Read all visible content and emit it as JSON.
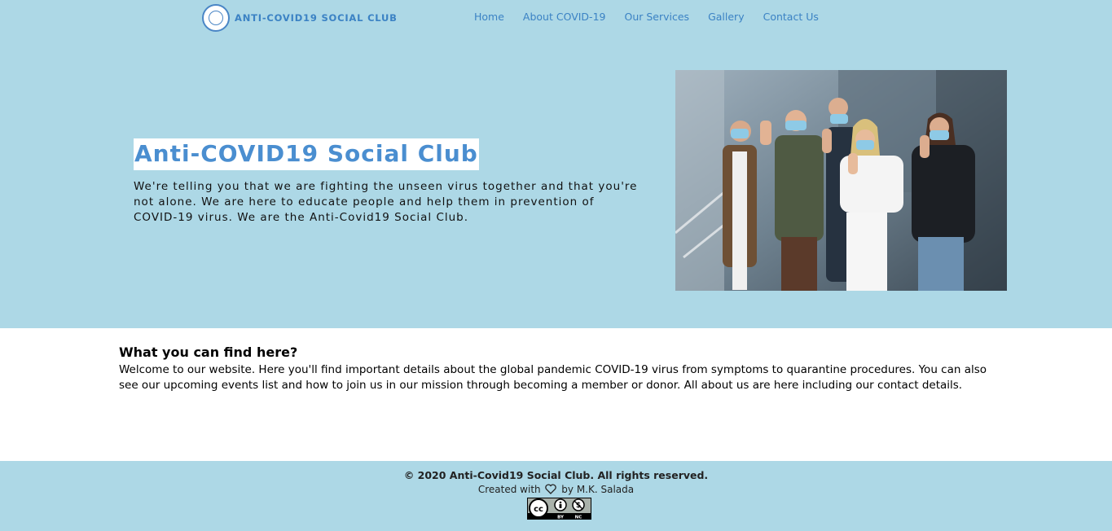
{
  "brand": {
    "name": "ANTI-COVID19 SOCIAL CLUB",
    "logo_icon": "club-logo-icon"
  },
  "nav": {
    "items": [
      {
        "label": "Home"
      },
      {
        "label": "About COVID-19"
      },
      {
        "label": "Our Services"
      },
      {
        "label": "Gallery"
      },
      {
        "label": "Contact Us"
      }
    ]
  },
  "hero": {
    "title": "Anti-COVID19 Social Club",
    "text": "We're telling you that we are fighting the unseen virus together and that you're not alone. We are here to educate people and help them in prevention of COVID-19 virus. We are the Anti-Covid19 Social Club.",
    "image_icon": "masked-group-photo"
  },
  "section": {
    "title": "What you can find here?",
    "text": "Welcome to our website. Here you'll find important details about the global pandemic COVID-19 virus from symptoms to quarantine procedures. You can also see our upcoming events list and how to join us in our mission through becoming a member or donor. All about us are here including our contact details."
  },
  "footer": {
    "copyright": "© 2020 Anti-Covid19 Social Club. All rights reserved.",
    "credit_prefix": "Created with",
    "credit_suffix": "by M.K. Salada",
    "heart_icon": "heart-icon",
    "license_icon": "cc-by-nc-icon",
    "license_labels": [
      "BY",
      "NC"
    ]
  },
  "colors": {
    "hero_background": "#add8e6",
    "accent": "#3b82c4",
    "title": "#4a8ed0"
  }
}
